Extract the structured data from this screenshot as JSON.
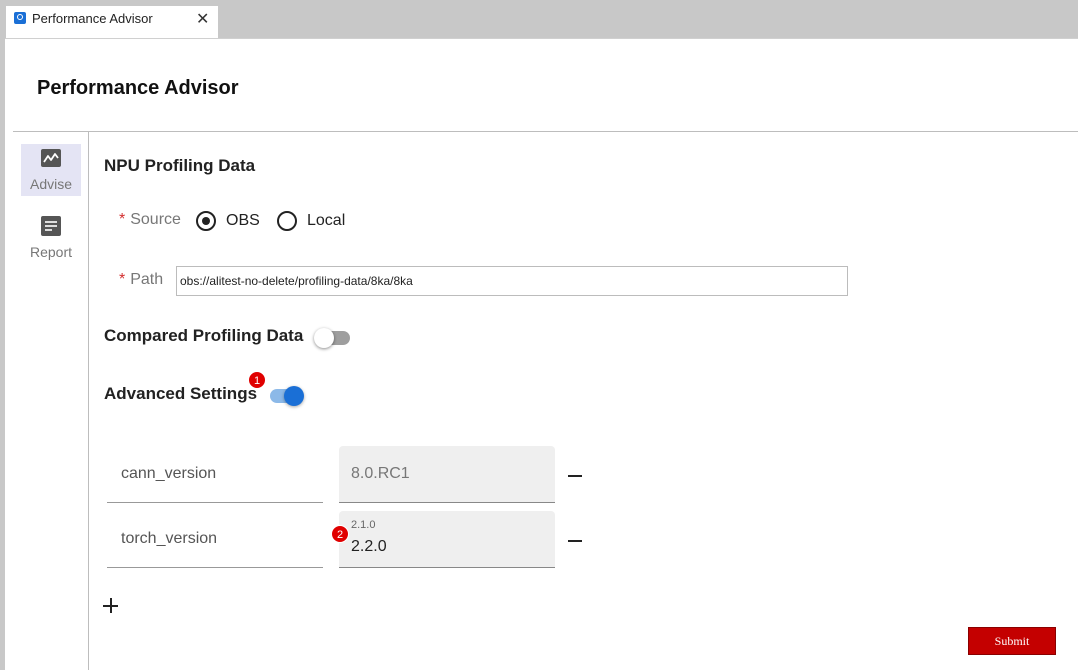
{
  "window": {
    "tab_title": "Performance Advisor",
    "close_symbol": "✕",
    "tab_icon": "app-icon",
    "accent_color": "#1a6fd6"
  },
  "page": {
    "title": "Performance Advisor"
  },
  "sidebar": {
    "items": [
      {
        "label": "Advise",
        "icon": "chart-line-icon",
        "active": true
      },
      {
        "label": "Report",
        "icon": "document-icon",
        "active": false
      }
    ]
  },
  "npu": {
    "section_title": "NPU Profiling Data",
    "source": {
      "label": "Source",
      "required_mark": "*",
      "options": [
        "OBS",
        "Local"
      ],
      "selected": "OBS"
    },
    "path": {
      "label": "Path",
      "required_mark": "*",
      "value": "obs://alitest-no-delete/profiling-data/8ka/8ka"
    }
  },
  "compared": {
    "label": "Compared Profiling Data",
    "enabled": false
  },
  "advanced": {
    "label": "Advanced Settings",
    "enabled": true,
    "badge": "1",
    "rows": [
      {
        "key": "cann_version",
        "value": "8.0.RC1",
        "hint": "",
        "editable": false
      },
      {
        "key": "torch_version",
        "value": "2.2.0",
        "hint": "2.1.0",
        "editable": true,
        "badge": "2"
      }
    ],
    "add_icon": "plus-icon",
    "remove_icon": "minus-icon"
  },
  "actions": {
    "submit_label": "Submit",
    "submit_color": "#c40000"
  }
}
